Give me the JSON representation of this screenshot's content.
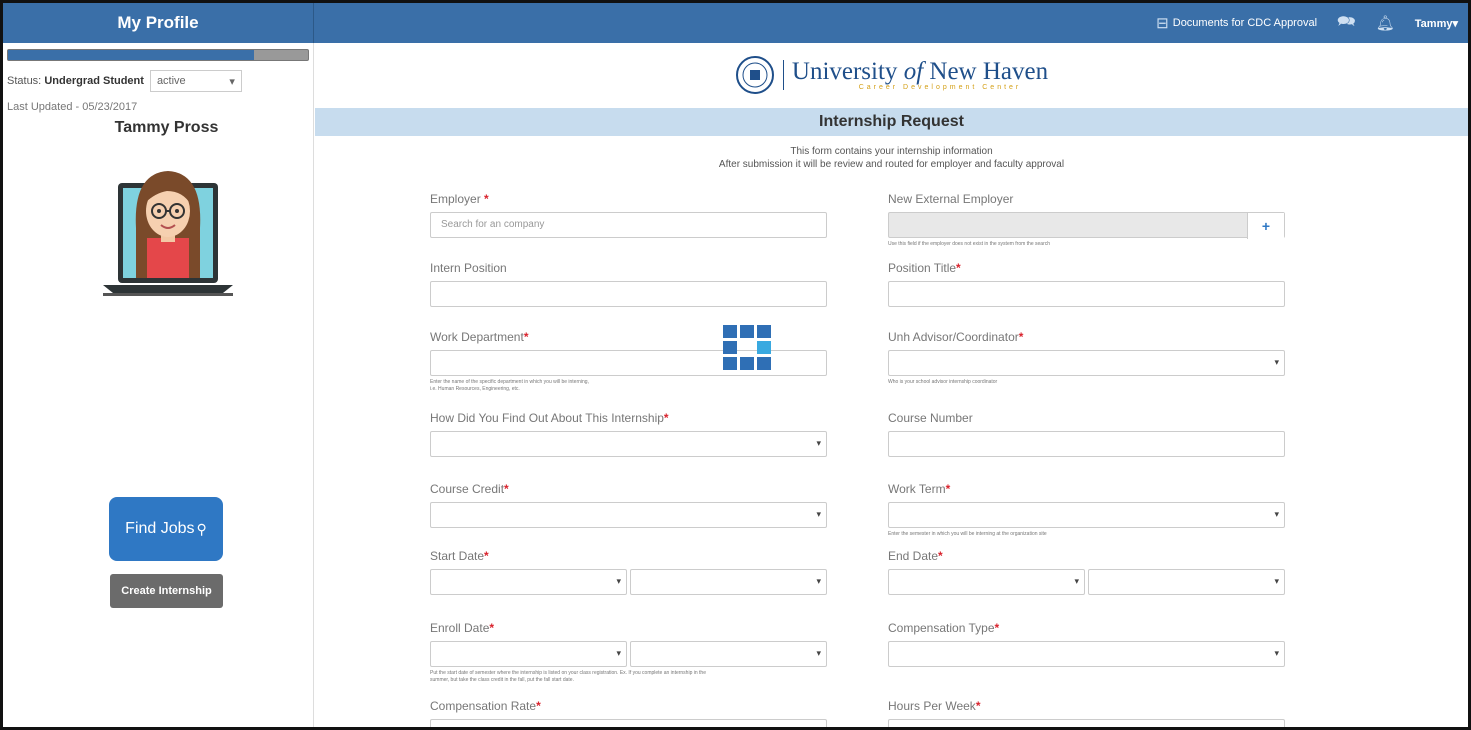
{
  "header": {
    "app_title": "My Profile",
    "documents_label": "Documents for CDC Approval",
    "user_menu": "Tammy"
  },
  "sidebar": {
    "profile_progress": 0.82,
    "status_label": "Status:",
    "status_value": "Undergrad Student",
    "status_select": "active",
    "last_updated": "Last Updated - 05/23/2017",
    "name": "Tammy Pross",
    "find_jobs_label": "Find Jobs",
    "create_internship_label": "Create Internship"
  },
  "brand": {
    "university_pre": "University ",
    "university_of": "of",
    "university_post": " New Haven",
    "subtitle": "Career Development Center"
  },
  "form": {
    "title": "Internship Request",
    "intro_line1": "This form contains your internship information",
    "intro_line2": "After submission it will be review and routed for employer and faculty approval",
    "employer_label": "Employer",
    "employer_placeholder": "Search for an company",
    "new_employer_label": "New External Employer",
    "new_employer_help": "Use this field if the employer does not exist in the system from the search",
    "intern_position_label": "Intern Position",
    "position_title_label": "Position Title",
    "work_department_label": "Work Department",
    "work_department_help_1": "Enter the name of the specific department in which you will be interning,",
    "work_department_help_2": "i.e. Human Resources, Engineering, etc.",
    "advisor_label": "Unh Advisor/Coordinator",
    "advisor_help": "Who is your school advisor internship coordinator",
    "how_found_label": "How Did You Find Out About This Internship",
    "course_number_label": "Course Number",
    "course_credit_label": "Course Credit",
    "work_term_label": "Work Term",
    "work_term_help": "Enter the semester in which you will be interning at the organization site",
    "start_date_label": "Start Date",
    "end_date_label": "End Date",
    "enroll_date_label": "Enroll Date",
    "enroll_help_1": "Put the start date of semester where the internship is listed on your class registration. Ex. If you complete an internship in the",
    "enroll_help_2": "summer, but take the class credit in the fall, put the fall start date.",
    "compensation_type_label": "Compensation Type",
    "compensation_rate_label": "Compensation Rate",
    "hours_per_week_label": "Hours Per Week",
    "required_mark": "*"
  },
  "colors": {
    "header_blue": "#3a6fa8",
    "title_bar": "#c7dcee",
    "button_blue": "#2f78c4",
    "required_red": "#d9232d"
  }
}
